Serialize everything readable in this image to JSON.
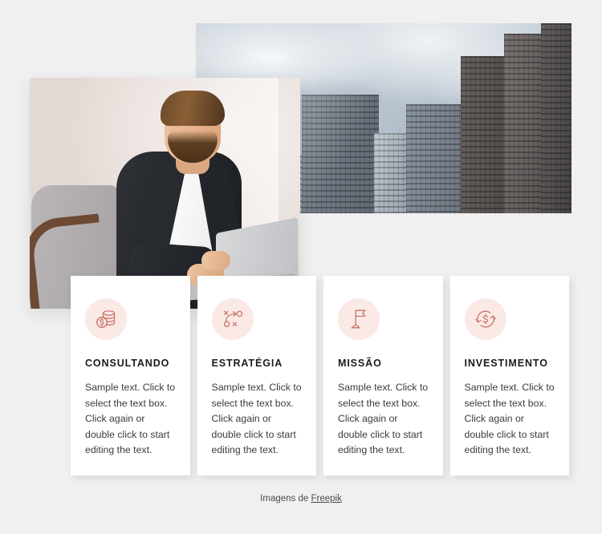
{
  "media": {
    "city_photo": {
      "alt": "city-skyscrapers-photo"
    },
    "man_photo": {
      "alt": "businessman-working-on-laptop-photo"
    }
  },
  "cards": [
    {
      "icon": "coins-stack-dollar-icon",
      "title": "CONSULTANDO",
      "body": "Sample text. Click to select the text box. Click again or double click to start editing the text."
    },
    {
      "icon": "strategy-playbook-icon",
      "title": "ESTRATÉGIA",
      "body": "Sample text. Click to select the text box. Click again or double click to start editing the text."
    },
    {
      "icon": "flag-icon",
      "title": "MISSÃO",
      "body": "Sample text. Click to select the text box. Click again or double click to start editing the text."
    },
    {
      "icon": "currency-exchange-refresh-icon",
      "title": "INVESTIMENTO",
      "body": "Sample text. Click to select the text box. Click again or double click to start editing the text."
    }
  ],
  "footer": {
    "prefix": "Imagens de ",
    "link_label": "Freepik"
  },
  "colors": {
    "page_background": "#f0f0f0",
    "card_background": "#ffffff",
    "icon_accent": "#c8776b",
    "icon_circle_background": "#fbe9e5",
    "title_text": "#1b1b1b",
    "body_text": "#3b3b3b",
    "footer_text": "#4a4a4a"
  }
}
